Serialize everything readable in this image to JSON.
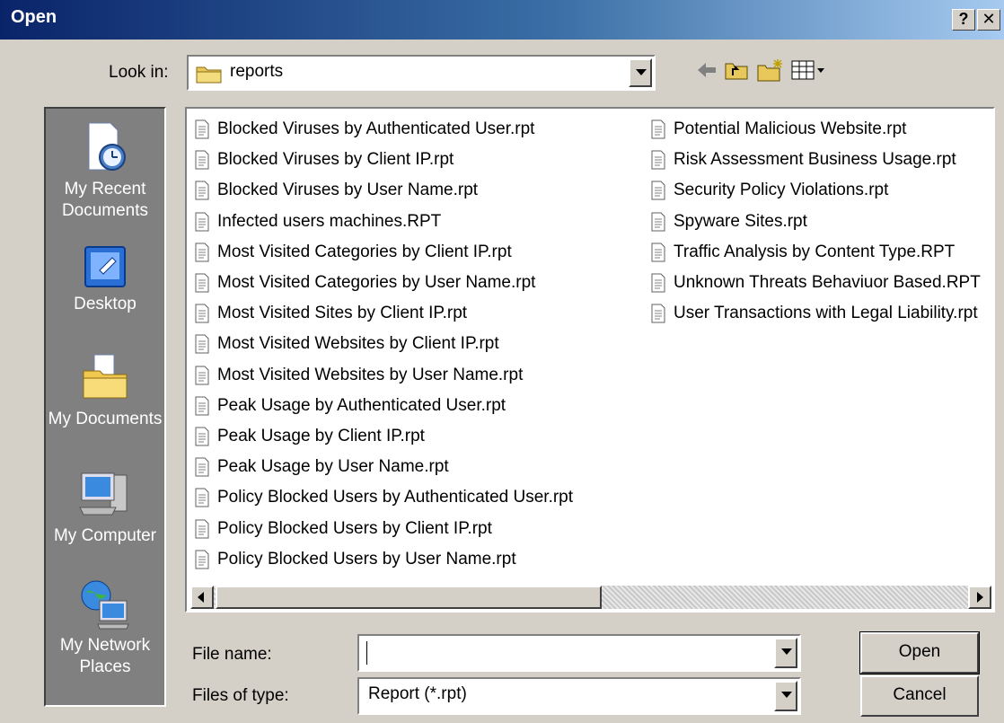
{
  "window": {
    "title": "Open",
    "help_button": "?",
    "close_button": "✕"
  },
  "look_in": {
    "label": "Look in:",
    "value": "reports"
  },
  "places": [
    {
      "name": "my-recent-documents",
      "label": "My Recent Documents",
      "icon": "recent-documents-icon"
    },
    {
      "name": "desktop",
      "label": "Desktop",
      "icon": "desktop-icon"
    },
    {
      "name": "my-documents",
      "label": "My Documents",
      "icon": "my-documents-icon"
    },
    {
      "name": "my-computer",
      "label": "My Computer",
      "icon": "my-computer-icon"
    },
    {
      "name": "my-network-places",
      "label": "My Network Places",
      "icon": "network-places-icon"
    }
  ],
  "files": {
    "column1": [
      "Blocked Viruses by Authenticated User.rpt",
      "Blocked Viruses by Client IP.rpt",
      "Blocked Viruses by User Name.rpt",
      "Infected users machines.RPT",
      "Most Visited Categories by Client IP.rpt",
      "Most Visited Categories by User Name.rpt",
      "Most Visited Sites by Client IP.rpt",
      "Most Visited Websites by Client IP.rpt",
      "Most Visited Websites by User Name.rpt",
      "Peak Usage by Authenticated User.rpt",
      "Peak Usage by Client IP.rpt",
      "Peak Usage by User Name.rpt",
      "Policy Blocked Users by Authenticated User.rpt",
      "Policy Blocked Users by Client IP.rpt",
      "Policy Blocked Users by User Name.rpt"
    ],
    "column2": [
      "Potential Malicious Website.rpt",
      "Risk Assessment Business Usage.rpt",
      "Security Policy Violations.rpt",
      "Spyware Sites.rpt",
      "Traffic Analysis by Content Type.RPT",
      "Unknown Threats Behaviuor Based.RPT",
      "User Transactions with Legal Liability.rpt"
    ]
  },
  "file_name": {
    "label": "File name:",
    "value": ""
  },
  "files_of_type": {
    "label": "Files of type:",
    "value": "Report (*.rpt)"
  },
  "buttons": {
    "open": "Open",
    "cancel": "Cancel"
  }
}
